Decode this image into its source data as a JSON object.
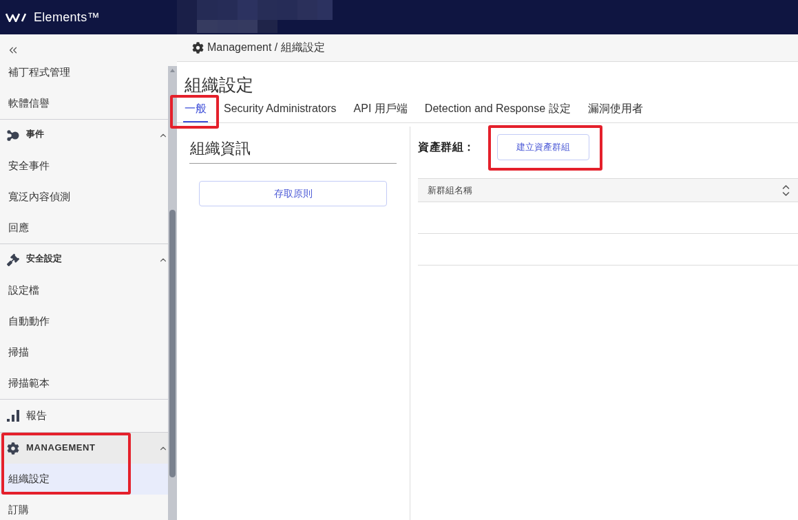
{
  "top_bar": {
    "brand": "Elements™"
  },
  "sidebar": {
    "sections": [
      {
        "kind": "list",
        "items": [
          {
            "label": "補丁程式管理",
            "selected": false
          },
          {
            "label": "軟體信譽",
            "selected": false
          }
        ]
      },
      {
        "kind": "group",
        "label": "事件",
        "expanded": true,
        "highlighted": false,
        "items": [
          {
            "label": "安全事件",
            "selected": false
          },
          {
            "label": "寬泛內容偵測",
            "selected": false
          },
          {
            "label": "回應",
            "selected": false
          }
        ]
      },
      {
        "kind": "group",
        "label": "安全設定",
        "expanded": true,
        "highlighted": false,
        "items": [
          {
            "label": "設定檔",
            "selected": false
          },
          {
            "label": "自動動作",
            "selected": false
          },
          {
            "label": "掃描",
            "selected": false
          },
          {
            "label": "掃描範本",
            "selected": false
          }
        ]
      },
      {
        "kind": "link",
        "label": "報告",
        "selected": false,
        "highlighted": false
      },
      {
        "kind": "group",
        "label": "MANAGEMENT",
        "expanded": true,
        "highlighted": true,
        "items": [
          {
            "label": "組織設定",
            "selected": true
          },
          {
            "label": "訂購",
            "selected": false
          }
        ]
      }
    ]
  },
  "breadcrumb": "Management / 組織設定",
  "page_title": "組織設定",
  "tabs": [
    {
      "label": "一般",
      "selected": true,
      "highlighted": true
    },
    {
      "label": "Security Administrators",
      "selected": false,
      "highlighted": false
    },
    {
      "label": "API 用戶端",
      "selected": false,
      "highlighted": false
    },
    {
      "label": "Detection and Response 設定",
      "selected": false,
      "highlighted": false
    },
    {
      "label": "漏洞使用者",
      "selected": false,
      "highlighted": false
    }
  ],
  "organization_info": {
    "heading": "組織資訊",
    "access_policy_button": {
      "label": "存取原則"
    }
  },
  "asset_groups": {
    "label": "資產群組：",
    "create_button": {
      "label": "建立資產群組",
      "highlighted": true
    },
    "table": {
      "columns": [
        {
          "label": "新群組名稱",
          "sortable": true
        }
      ]
    }
  }
}
